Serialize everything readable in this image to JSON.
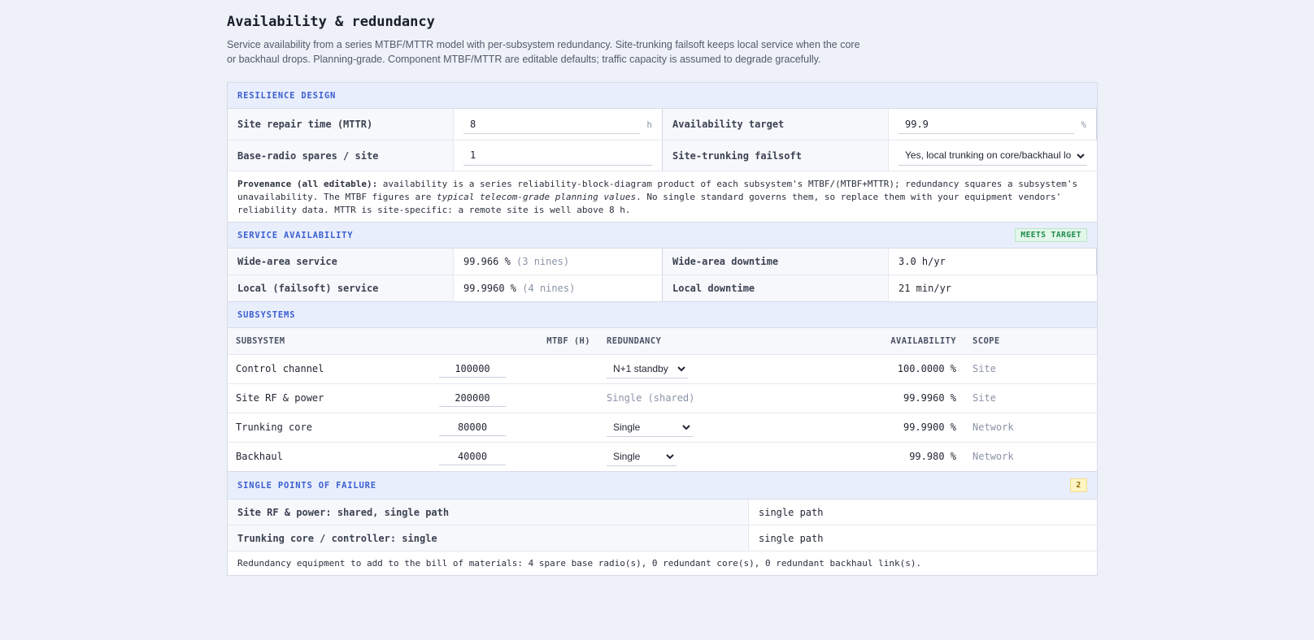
{
  "page": {
    "title": "Availability & redundancy",
    "intro": "Service availability from a series MTBF/MTTR model with per-subsystem redundancy. Site-trunking failsoft keeps local service when the core or backhaul drops. Planning-grade. Component MTBF/MTTR are editable defaults; traffic capacity is assumed to degrade gracefully."
  },
  "resilience": {
    "header": "RESILIENCE DESIGN",
    "mttr_label": "Site repair time (MTTR)",
    "mttr_value": "8",
    "mttr_unit": "h",
    "target_label": "Availability target",
    "target_value": "99.9",
    "target_unit": "%",
    "spares_label": "Base-radio spares / site",
    "spares_value": "1",
    "failsoft_label": "Site-trunking failsoft",
    "failsoft_selected": "Yes, local trunking on core/backhaul loss",
    "prov_bold": "Provenance (all editable):",
    "prov_1": " availability is a series reliability-block-diagram product of each subsystem's MTBF/(MTBF+MTTR); redundancy squares a subsystem's unavailability. The MTBF figures are ",
    "prov_em": "typical telecom-grade planning values",
    "prov_2": ". No single standard governs them, so replace them with your equipment vendors' reliability data. MTTR is site-specific: a remote site is well above 8 h."
  },
  "service": {
    "header": "SERVICE AVAILABILITY",
    "badge": "MEETS TARGET",
    "wide_label": "Wide-area service",
    "wide_value": "99.966 %",
    "wide_nines": "(3 nines)",
    "wide_down_label": "Wide-area downtime",
    "wide_down_value": "3.0 h/yr",
    "local_label": "Local (failsoft) service",
    "local_value": "99.9960 %",
    "local_nines": "(4 nines)",
    "local_down_label": "Local downtime",
    "local_down_value": "21 min/yr"
  },
  "subsystems": {
    "header": "SUBSYSTEMS",
    "columns": {
      "name": "SUBSYSTEM",
      "mtbf": "MTBF (H)",
      "redundancy": "REDUNDANCY",
      "availability": "AVAILABILITY",
      "scope": "SCOPE"
    },
    "rows": [
      {
        "name": "Control channel",
        "mtbf": "100000",
        "redundancy": "N+1 standby",
        "availability": "100.0000 %",
        "scope": "Site"
      },
      {
        "name": "Site RF & power",
        "mtbf": "200000",
        "redundancy": "Single (shared)",
        "availability": "99.9960 %",
        "scope": "Site"
      },
      {
        "name": "Trunking core",
        "mtbf": "80000",
        "redundancy": "Single",
        "availability": "99.9900 %",
        "scope": "Network"
      },
      {
        "name": "Backhaul",
        "mtbf": "40000",
        "redundancy": "Single",
        "availability": "99.980 %",
        "scope": "Network"
      }
    ]
  },
  "spof": {
    "header": "SINGLE POINTS OF FAILURE",
    "count": "2",
    "items": [
      {
        "label": "Site RF & power: shared, single path",
        "value": "single path"
      },
      {
        "label": "Trunking core / controller: single",
        "value": "single path"
      }
    ],
    "note": "Redundancy equipment to add to the bill of materials: 4 spare base radio(s), 0 redundant core(s), 0 redundant backhaul link(s)."
  }
}
